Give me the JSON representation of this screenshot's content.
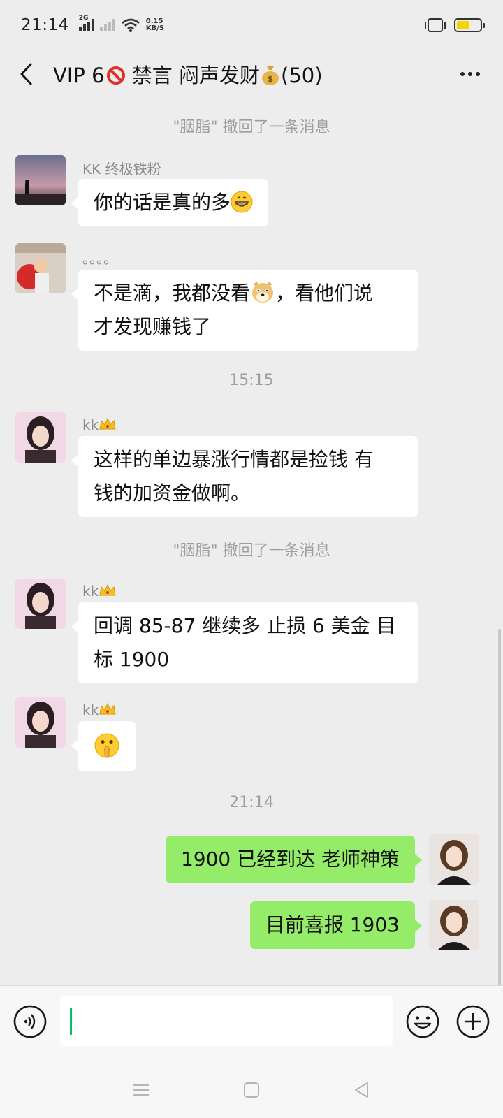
{
  "status_bar": {
    "time": "21:14",
    "network_tag": "2G",
    "speed_value": "0.15",
    "speed_unit": "KB/S",
    "battery_color": "#f2d600"
  },
  "header": {
    "title_part1": "VIP 6",
    "title_part2": " 禁言 闷声发财",
    "title_part3": "(50)",
    "back_icon": "back-arrow-icon",
    "more_icon": "more-dots-icon"
  },
  "messages": [
    {
      "type": "system",
      "text": "\"胭脂\" 撤回了一条消息"
    },
    {
      "type": "left",
      "sender": "KK 终极铁粉",
      "text": "你的话是真的多",
      "emoji": "grinning-face"
    },
    {
      "type": "left",
      "sender": "。。。。",
      "line1_a": "不是滴，我都没看",
      "line1_emoji": "doge-face",
      "line1_b": "，看他们说",
      "line2": "才发现赚钱了"
    },
    {
      "type": "time",
      "text": "15:15"
    },
    {
      "type": "left",
      "sender": "kk",
      "line1": "这样的单边暴涨行情都是捡钱 有",
      "line2": "钱的加资金做啊。"
    },
    {
      "type": "system",
      "text": "\"胭脂\" 撤回了一条消息"
    },
    {
      "type": "left",
      "sender": "kk",
      "line1": "回调 85-87 继续多 止损 6 美金 目",
      "line2": "标 1900"
    },
    {
      "type": "left",
      "sender": "kk",
      "emoji": "shushing-face"
    },
    {
      "type": "time",
      "text": "21:14"
    },
    {
      "type": "right",
      "text": "1900 已经到达 老师神策"
    },
    {
      "type": "right",
      "text": "目前喜报 1903"
    }
  ],
  "colors": {
    "background": "#ededed",
    "bubble_left": "#ffffff",
    "bubble_right": "#95ec69",
    "system_text": "#9e9e9e",
    "caret": "#07c160"
  },
  "input_bar": {
    "voice_icon": "voice-icon",
    "emoji_icon": "emoji-icon",
    "plus_icon": "plus-icon",
    "value": ""
  },
  "nav_bar": {
    "menu_icon": "menu-icon",
    "home_icon": "home-square-icon",
    "back_icon": "back-triangle-icon"
  }
}
